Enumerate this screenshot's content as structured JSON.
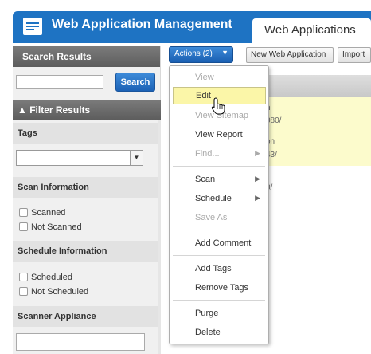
{
  "header": {
    "app_title": "Web Application Management",
    "active_tab": "Web Applications",
    "accent": "#1e73c3"
  },
  "sidebar": {
    "search_title": "Search Results",
    "search_placeholder": "",
    "search_button": "Search",
    "filter_title": "▲ Filter Results",
    "sections": {
      "tags": "Tags",
      "scan_information": "Scan Information",
      "schedule_information": "Schedule Information",
      "scanner_appliance": "Scanner Appliance"
    },
    "scan_options": [
      "Scanned",
      "Not Scanned"
    ],
    "schedule_options": [
      "Scheduled",
      "Not Scheduled"
    ]
  },
  "toolbar": {
    "actions_label": "Actions (2)",
    "new_web_app": "New Web Application",
    "import": "Import"
  },
  "table": {
    "rows": [
      {
        "line1": "n",
        "line2": "080/"
      },
      {
        "line1": "on",
        "line2": "43/"
      },
      {
        "line1": "",
        "line2": "0/"
      }
    ]
  },
  "menu": {
    "items": [
      {
        "label": "View",
        "disabled": true
      },
      {
        "label": "Edit",
        "highlighted": true
      },
      {
        "label": "View Sitemap",
        "disabled": true
      },
      {
        "label": "View Report"
      },
      {
        "label": "Find...",
        "disabled": true,
        "submenu": true
      },
      {
        "label": "Scan",
        "submenu": true
      },
      {
        "label": "Schedule",
        "submenu": true
      },
      {
        "label": "Save As",
        "disabled": true
      },
      {
        "label": "Add Comment"
      },
      {
        "label": "Add Tags"
      },
      {
        "label": "Remove Tags"
      },
      {
        "label": "Purge"
      },
      {
        "label": "Delete"
      }
    ]
  }
}
